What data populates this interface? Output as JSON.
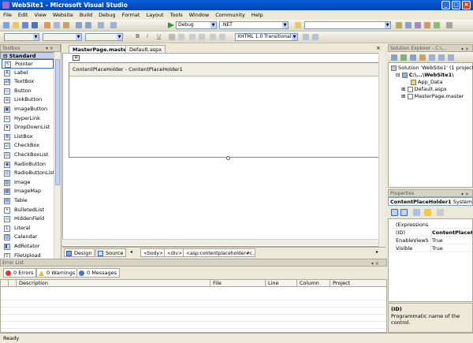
{
  "window": {
    "title": "WebSite1 - Microsoft Visual Studio",
    "minimize": "_",
    "maximize": "□",
    "close": "×"
  },
  "menu": [
    "File",
    "Edit",
    "View",
    "Website",
    "Build",
    "Debug",
    "Format",
    "Layout",
    "Tools",
    "Window",
    "Community",
    "Help"
  ],
  "toolbar1": {
    "config": "Debug",
    "platform": ".NET"
  },
  "toolbar2": {
    "bold": "B",
    "italic": "I",
    "underline": "U",
    "doctype": "XHTML 1.0 Transitional ("
  },
  "toolbox": {
    "title": "Toolbox",
    "section": "Standard",
    "items": [
      "Pointer",
      "Label",
      "TextBox",
      "Button",
      "LinkButton",
      "ImageButton",
      "HyperLink",
      "DropDownList",
      "ListBox",
      "CheckBox",
      "CheckBoxList",
      "RadioButton",
      "RadioButtonList",
      "Image",
      "ImageMap",
      "Table",
      "BulletedList",
      "HiddenField",
      "Literal",
      "Calendar",
      "AdRotator",
      "FileUpload"
    ],
    "icons": [
      "↖",
      "A",
      "ab",
      "▭",
      "≡",
      "▣",
      "∞",
      "▾",
      "≣",
      "☑",
      "☷",
      "◉",
      "◎",
      "▨",
      "▦",
      "▤",
      "•",
      "▫",
      "L",
      "▥",
      "◧",
      "⇪"
    ]
  },
  "document": {
    "tabs": [
      "MasterPage.master",
      "Default.aspx"
    ],
    "placeholder_label": "ContentPlaceHolder - ContentPlaceHolder1",
    "views": [
      "Design",
      "Source"
    ],
    "breadcrumbs": [
      "<body>",
      "<div>",
      "<asp:contentplaceholder#c..."
    ]
  },
  "error_list": {
    "title": "Error List",
    "buttons": [
      "0 Errors",
      "0 Warnings",
      "0 Messages"
    ],
    "columns": [
      "Description",
      "File",
      "Line",
      "Column",
      "Project"
    ]
  },
  "solution_explorer": {
    "title": "Solution Explorer - C:\\...",
    "nodes": [
      "Solution 'WebSite1' (1 project)",
      "C:\\...\\WebSite1\\",
      "App_Data",
      "Default.aspx",
      "MasterPage.master"
    ]
  },
  "properties": {
    "title": "Properties",
    "selected": "ContentPlaceHolder1",
    "selected_type": "System.",
    "rows": [
      {
        "name": "(Expressions)",
        "value": ""
      },
      {
        "name": "(ID)",
        "value": "ContentPlaceHo"
      },
      {
        "name": "EnableViewSta",
        "value": "True"
      },
      {
        "name": "Visible",
        "value": "True"
      }
    ],
    "desc_title": "(ID)",
    "desc_text": "Programmatic name of the control."
  },
  "status": {
    "text": "Ready"
  },
  "colors": {
    "titlebar": "#0a5fd8",
    "accent": "#316ac5"
  }
}
